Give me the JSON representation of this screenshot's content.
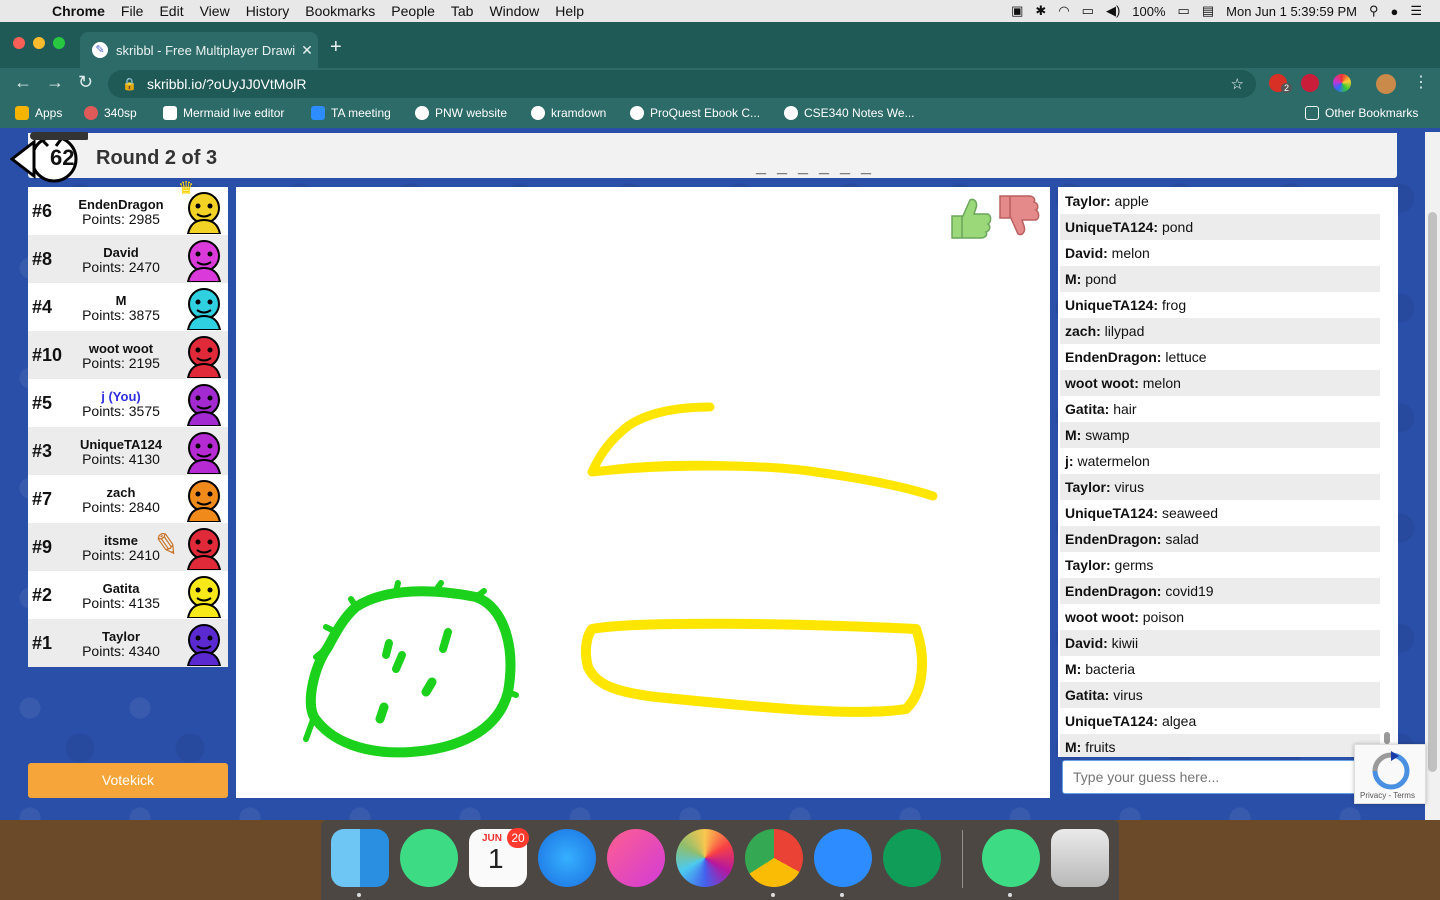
{
  "menubar": {
    "apple": "",
    "app_name": "Chrome",
    "items": [
      "File",
      "Edit",
      "View",
      "History",
      "Bookmarks",
      "People",
      "Tab",
      "Window",
      "Help"
    ],
    "battery": "100%",
    "clock": "Mon Jun 1  5:39:59 PM"
  },
  "browser": {
    "tab_title": "skribbl - Free Multiplayer Drawing",
    "tab_close": "✕",
    "new_tab": "+",
    "url": "skribbl.io/?oUyJJ0VtMolR",
    "ext_badge": "2"
  },
  "bookmarks": [
    {
      "label": "Apps",
      "color": "#f5b400"
    },
    {
      "label": "340sp",
      "color": "#e05a5a"
    },
    {
      "label": "Mermaid live editor",
      "color": "#ffffff"
    },
    {
      "label": "TA meeting",
      "color": "#2d8cff"
    },
    {
      "label": "PNW website",
      "color": "#ffffff"
    },
    {
      "label": "kramdown",
      "color": "#ffffff"
    },
    {
      "label": "ProQuest Ebook C...",
      "color": "#ffffff"
    },
    {
      "label": "CSE340 Notes We...",
      "color": "#ffffff"
    }
  ],
  "other_bookmarks": "Other Bookmarks",
  "game": {
    "timer": "62",
    "round": "Round 2 of 3",
    "word_hint": "_ _ _ _ _ _",
    "votekick": "Votekick",
    "speech": "fruits",
    "players": [
      {
        "rank": "#6",
        "name": "EndenDragon",
        "points": "Points: 2985",
        "color": "#f2d224",
        "you": false
      },
      {
        "rank": "#8",
        "name": "David",
        "points": "Points: 2470",
        "color": "#d93ad9",
        "you": false
      },
      {
        "rank": "#4",
        "name": "M",
        "points": "Points: 3875",
        "color": "#2fd0e0",
        "you": false
      },
      {
        "rank": "#10",
        "name": "woot woot",
        "points": "Points: 2195",
        "color": "#e02a3a",
        "you": false
      },
      {
        "rank": "#5",
        "name": "j (You)",
        "points": "Points: 3575",
        "color": "#a22ad0",
        "you": true
      },
      {
        "rank": "#3",
        "name": "UniqueTA124",
        "points": "Points: 4130",
        "color": "#b62ad4",
        "you": false
      },
      {
        "rank": "#7",
        "name": "zach",
        "points": "Points: 2840",
        "color": "#f08a1a",
        "you": false
      },
      {
        "rank": "#9",
        "name": "itsme",
        "points": "Points: 2410",
        "color": "#e02a3a",
        "you": false
      },
      {
        "rank": "#2",
        "name": "Gatita",
        "points": "Points: 4135",
        "color": "#f7e81a",
        "you": false
      },
      {
        "rank": "#1",
        "name": "Taylor",
        "points": "Points: 4340",
        "color": "#5a2ad0",
        "you": false
      }
    ],
    "chat": [
      {
        "who": "Taylor:",
        "text": " apple"
      },
      {
        "who": "UniqueTA124:",
        "text": " pond"
      },
      {
        "who": "David:",
        "text": " melon"
      },
      {
        "who": "M:",
        "text": " pond"
      },
      {
        "who": "UniqueTA124:",
        "text": " frog"
      },
      {
        "who": "zach:",
        "text": " lilypad"
      },
      {
        "who": "EndenDragon:",
        "text": " lettuce"
      },
      {
        "who": "woot woot:",
        "text": " melon"
      },
      {
        "who": "Gatita:",
        "text": " hair"
      },
      {
        "who": "M:",
        "text": " swamp"
      },
      {
        "who": "j:",
        "text": " watermelon"
      },
      {
        "who": "Taylor:",
        "text": " virus"
      },
      {
        "who": "UniqueTA124:",
        "text": " seaweed"
      },
      {
        "who": "EndenDragon:",
        "text": " salad"
      },
      {
        "who": "Taylor:",
        "text": " germs"
      },
      {
        "who": "EndenDragon:",
        "text": " covid19"
      },
      {
        "who": "woot woot:",
        "text": " poison"
      },
      {
        "who": "David:",
        "text": " kiwii"
      },
      {
        "who": "M:",
        "text": " bacteria"
      },
      {
        "who": "Gatita:",
        "text": " virus"
      },
      {
        "who": "UniqueTA124:",
        "text": " algea"
      },
      {
        "who": "M:",
        "text": " fruits"
      }
    ],
    "guess_placeholder": "Type your guess here...",
    "recaptcha_terms": "Privacy - Terms",
    "stroke_colors": {
      "yellow": "#ffe600",
      "green": "#1cd11c"
    }
  },
  "dock": {
    "apps": [
      "finder-icon",
      "android-studio-icon",
      "calendar-icon",
      "app-store-icon",
      "music-icon",
      "photos-icon",
      "chrome-icon",
      "zoom-icon",
      "email-icon",
      "android-studio-icon",
      "trash-icon"
    ],
    "calendar_month": "JUN",
    "calendar_day": "1",
    "calendar_badge": "20"
  }
}
